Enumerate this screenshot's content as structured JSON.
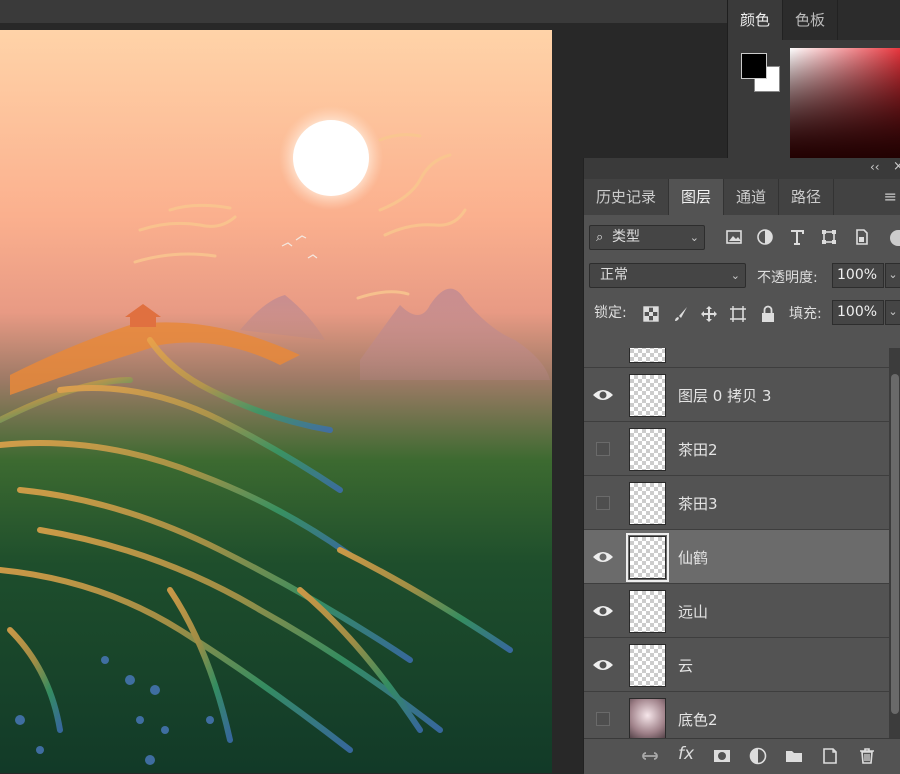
{
  "color_panel": {
    "tabs": [
      "颜色",
      "色板"
    ]
  },
  "layers_panel": {
    "tabs": [
      "历史记录",
      "图层",
      "通道",
      "路径"
    ],
    "filter_kind": "类型",
    "blend_mode": "正常",
    "opacity_label": "不透明度:",
    "opacity_value": "100%",
    "lock_label": "锁定:",
    "fill_label": "填充:",
    "fill_value": "100%",
    "layers": [
      {
        "name": "",
        "visible": true,
        "selected": false
      },
      {
        "name": "图层 0 拷贝 3",
        "visible": true,
        "selected": false
      },
      {
        "name": "茶田2",
        "visible": false,
        "selected": false
      },
      {
        "name": "茶田3",
        "visible": false,
        "selected": false
      },
      {
        "name": "仙鹤",
        "visible": true,
        "selected": true
      },
      {
        "name": "远山",
        "visible": true,
        "selected": false
      },
      {
        "name": "云",
        "visible": true,
        "selected": false
      },
      {
        "name": "底色2",
        "visible": false,
        "selected": false
      }
    ],
    "bottom_icons": [
      "link-icon",
      "fx-icon",
      "mask-icon",
      "adjustment-icon",
      "folder-icon",
      "new-layer-icon",
      "trash-icon"
    ],
    "fx_label": "fx"
  },
  "colors": {
    "foreground": "#000000",
    "background": "#ffffff",
    "selected_layer": "#6b6b6b"
  }
}
